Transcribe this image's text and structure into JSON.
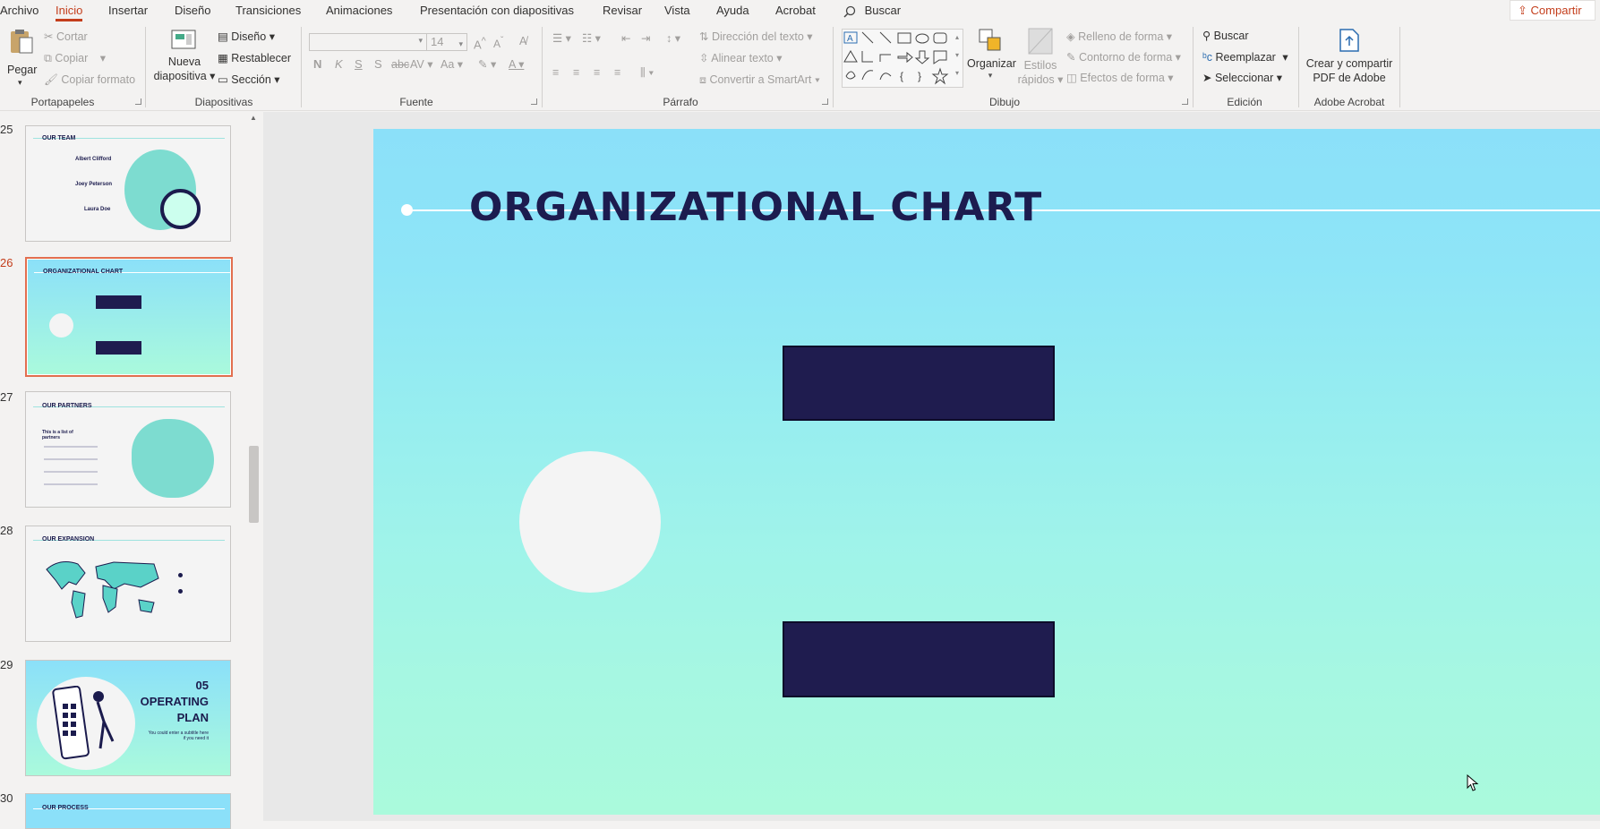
{
  "menu": {
    "tabs": [
      "Archivo",
      "Inicio",
      "Insertar",
      "Diseño",
      "Transiciones",
      "Animaciones",
      "Presentación con diapositivas",
      "Revisar",
      "Vista",
      "Ayuda",
      "Acrobat"
    ],
    "search": "Buscar",
    "share": "Compartir"
  },
  "ribbon": {
    "portapapeles": {
      "label": "Portapapeles",
      "paste": "Pegar",
      "cut": "Cortar",
      "copy": "Copiar",
      "format_painter": "Copiar formato"
    },
    "diapositivas": {
      "label": "Diapositivas",
      "new_slide_1": "Nueva",
      "new_slide_2": "diapositiva",
      "layout": "Diseño",
      "reset": "Restablecer",
      "section": "Sección"
    },
    "fuente": {
      "label": "Fuente",
      "font_name": "",
      "font_size": "14"
    },
    "parrafo": {
      "label": "Párrafo",
      "text_direction": "Dirección del texto",
      "align_text": "Alinear texto",
      "convert_smartart": "Convertir a SmartArt"
    },
    "dibujo": {
      "label": "Dibujo",
      "arrange": "Organizar",
      "quick_styles_1": "Estilos",
      "quick_styles_2": "rápidos",
      "shape_fill": "Relleno de forma",
      "shape_outline": "Contorno de forma",
      "shape_effects": "Efectos de forma"
    },
    "edicion": {
      "label": "Edición",
      "find": "Buscar",
      "replace": "Reemplazar",
      "select": "Seleccionar"
    },
    "acrobat": {
      "label": "Adobe Acrobat",
      "create_1": "Crear y compartir",
      "create_2": "PDF de Adobe"
    }
  },
  "thumbnails": [
    {
      "num": "25",
      "title": "OUR TEAM",
      "names": [
        "Albert Clifford",
        "Joey Peterson",
        "Laura Doe"
      ]
    },
    {
      "num": "26",
      "title": "ORGANIZATIONAL CHART"
    },
    {
      "num": "27",
      "title": "OUR PARTNERS",
      "subtitle": "This is a list of partners"
    },
    {
      "num": "28",
      "title": "OUR EXPANSION"
    },
    {
      "num": "29",
      "title_line1": "05",
      "title_line2": "OPERATING",
      "title_line3": "PLAN",
      "subtitle": "You could enter a subtitle here if you need it"
    },
    {
      "num": "30",
      "title": "OUR PROCESS"
    }
  ],
  "slide": {
    "title": "ORGANIZATIONAL CHART"
  },
  "colors": {
    "accent": "#c43e1c",
    "slide_dark": "#1f1c4f",
    "selection": "#e26f4f"
  }
}
